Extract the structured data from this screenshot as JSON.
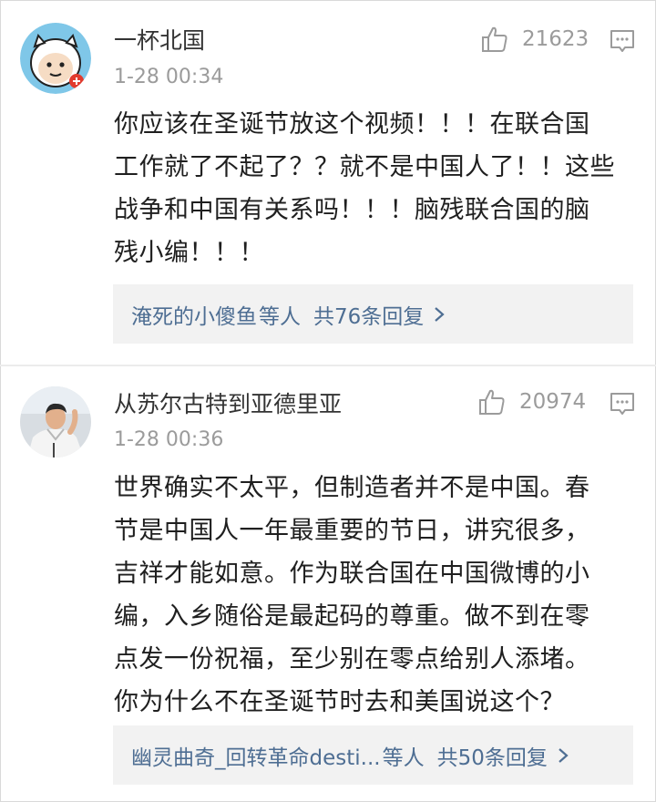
{
  "comments": [
    {
      "username": "一杯北国",
      "time": "1-28 00:34",
      "likes": "21623",
      "lines": [
        "你应该在圣诞节放这个视频！！！在联合国",
        "工作就了不起了？？就不是中国人了！！这些",
        "战争和中国有关系吗！！！脑残联合国的脑",
        "残小编！！！"
      ],
      "reply_names": "淹死的小傻鱼",
      "reply_deng": "等人",
      "reply_total": "共76条回复"
    },
    {
      "username": "从苏尔古特到亚德里亚",
      "time": "1-28 00:36",
      "likes": "20974",
      "lines": [
        "世界确实不太平，但制造者并不是中国。春",
        "节是中国人一年最重要的节日，讲究很多，",
        "吉祥才能如意。作为联合国在中国微博的小",
        "编，入乡随俗是最起码的尊重。做不到在零",
        "点发一份祝福，至少别在零点给别人添堵。",
        "你为什么不在圣诞节时去和美国说这个？"
      ],
      "reply_names": "幽灵曲奇_回转革命desti...",
      "reply_deng": "等人",
      "reply_total": "共50条回复"
    }
  ],
  "colors": {
    "link": "#4e6e93",
    "meta": "#9b9b9b",
    "reply_bg": "#f2f2f2"
  },
  "icons": [
    "thumbs-up-icon",
    "comment-reply-icon",
    "chevron-right-icon"
  ]
}
